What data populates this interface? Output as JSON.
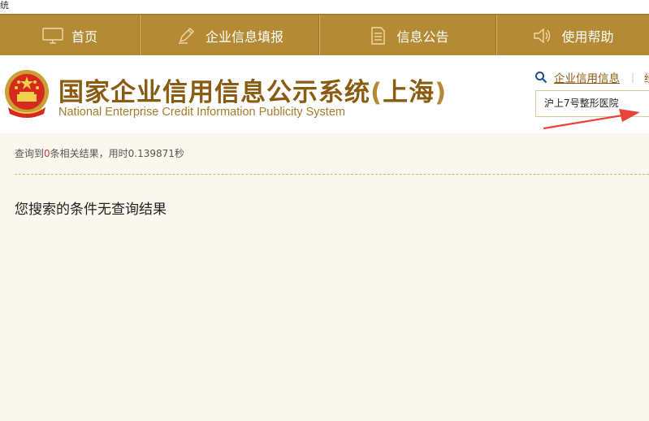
{
  "window_title_fragment": "统",
  "nav": {
    "items": [
      {
        "label": "首页",
        "icon": "monitor-icon"
      },
      {
        "label": "企业信息填报",
        "icon": "pen-icon"
      },
      {
        "label": "信息公告",
        "icon": "document-icon"
      },
      {
        "label": "使用帮助",
        "icon": "speaker-icon"
      }
    ]
  },
  "header": {
    "title_cn": "国家企业信用信息公示系统",
    "title_region_open": "(",
    "title_region": "上海",
    "title_region_close": ")",
    "title_en": "National Enterprise Credit Information Publicity System",
    "search_link": "企业信用信息",
    "separator": "|",
    "more_link": "经",
    "search_value": "沪上7号整形医院"
  },
  "results": {
    "prefix": "查询到",
    "count": "0",
    "suffix": "条相关结果，用时0.139871秒",
    "no_result_message": "您搜索的条件无查询结果"
  },
  "colors": {
    "nav_bg": "#b48a34",
    "title": "#8a5c12",
    "count_highlight": "#e0322e",
    "arrow": "#e8443a"
  }
}
